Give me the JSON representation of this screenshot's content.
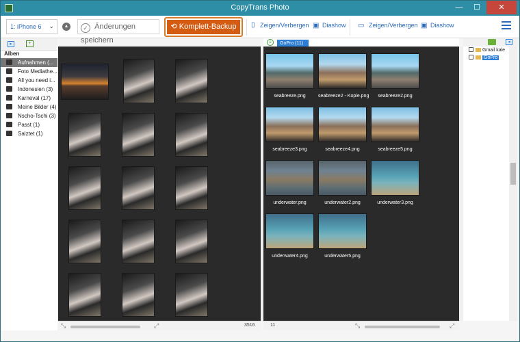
{
  "window": {
    "title": "CopyTrans Photo",
    "minimize_icon": "minimize-icon",
    "maximize_icon": "maximize-icon",
    "close_label": "✕"
  },
  "toolbar": {
    "device_label": "1: iPhone 6",
    "save_label": "Änderungen speichern",
    "backup_label": "Komplett-Backup",
    "device_show_hide": "Zeigen/Verbergen",
    "device_slideshow": "Diashow",
    "pc_show_hide": "Zeigen/Verbergen",
    "pc_slideshow": "Diashow"
  },
  "albums": {
    "header": "Alben",
    "items": [
      {
        "label": "Aufnahmen (...",
        "selected": true
      },
      {
        "label": "Foto Mediathe..."
      },
      {
        "label": "All you need i..."
      },
      {
        "label": "Indonesien (3)"
      },
      {
        "label": "Karneval (17)"
      },
      {
        "label": "Meine Bilder (4)"
      },
      {
        "label": "Nscho-Tschi (3)"
      },
      {
        "label": "Passt (1)"
      },
      {
        "label": "Salztet (1)"
      }
    ]
  },
  "device_grid": {
    "count_label": "3516"
  },
  "pc": {
    "tab_label": "GoPro (11)",
    "count_label": "11",
    "photos": [
      "seabreeze.png",
      "seabreeze2 - Kopie.png",
      "seabreeze2.png",
      "seabreeze3.png",
      "seabreeze4.png",
      "seabreeze5.png",
      "underwater.png",
      "underwater2.png",
      "underwater3.png",
      "underwater4.png",
      "underwater5.png"
    ]
  },
  "tree": {
    "items": [
      {
        "label": "Gmail kale"
      },
      {
        "label": "GoPro",
        "selected": true
      }
    ]
  },
  "colors": {
    "accent": "#2d8ea6",
    "backup": "#d45c12",
    "link": "#2b6ab8"
  }
}
